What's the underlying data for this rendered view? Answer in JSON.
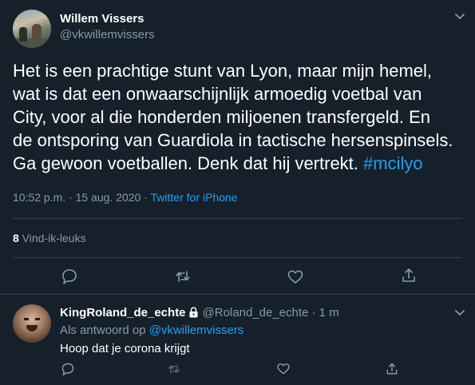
{
  "main_tweet": {
    "author_name": "Willem Vissers",
    "author_handle": "@vkwillemvissers",
    "text": "Het is een prachtige stunt van Lyon, maar mijn hemel,\nwat is dat een onwaarschijnlijk armoedig voetbal van\nCity, voor al die honderden miljoenen transfergeld. En\nde ontsporing van Guardiola in tactische hersenspinsels.\nGa gewoon voetballen. Denk dat hij vertrekt. ",
    "hashtag": "#mcilyo",
    "time": "10:52 p.m. · 15 aug. 2020 · ",
    "source": "Twitter for iPhone",
    "likes_count": "8",
    "likes_label": " Vind-ik-leuks",
    "icons": [
      "chevron-down-icon",
      "reply-icon",
      "retweet-icon",
      "like-icon",
      "share-icon"
    ]
  },
  "reply_tweet": {
    "author_name": "KingRoland_de_echte",
    "author_handle": "@Roland_de_echte · 1 m",
    "reply_prefix": "Als antwoord op ",
    "reply_to_handle": "@vkwillemvissers",
    "text": "Hoop dat je corona krijgt",
    "icons": [
      "lock-icon",
      "chevron-down-icon",
      "reply-icon",
      "retweet-icon",
      "like-icon",
      "share-icon"
    ]
  },
  "colors": {
    "background": "#15202b",
    "text": "#ffffff",
    "secondary_text": "#8899a6",
    "accent": "#1da1f2",
    "divider": "#38444d"
  }
}
